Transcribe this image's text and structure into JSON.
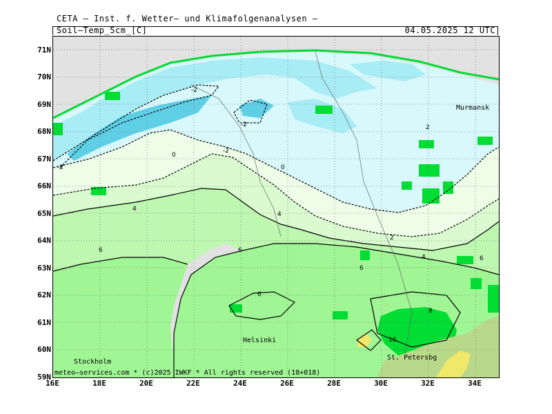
{
  "header": {
    "title": "CETA — Inst. f. Wetter— und Klimafolgenanalysen —",
    "variable": "Soil—Temp_5cm_[C]",
    "datetime": "04.05.2025 12 UTC"
  },
  "map": {
    "lat_labels": [
      "71N",
      "70N",
      "69N",
      "68N",
      "67N",
      "66N",
      "65N",
      "64N",
      "63N",
      "62N",
      "61N",
      "60N",
      "59N"
    ],
    "lon_labels": [
      "16E",
      "18E",
      "20E",
      "22E",
      "24E",
      "26E",
      "28E",
      "30E",
      "32E",
      "34E"
    ],
    "place_labels": {
      "murmansk": "Murmansk",
      "helsinki": "Helsinki",
      "stockholm": "Stockholm",
      "st_petersburg": "St. Petersbg"
    },
    "contour_labels": [
      "-2",
      "-2",
      "-2",
      "0",
      "0",
      "-2",
      "2",
      "4",
      "4",
      "6",
      "6",
      "6",
      "6",
      "4",
      "2",
      "6",
      "8",
      "10"
    ],
    "colors": {
      "below_neg4": "#5fcfe6",
      "neg4_neg2": "#a8ecf5",
      "neg2_0": "#d8f8fb",
      "0_2": "#eefde8",
      "2_4": "#d9fbcf",
      "4_6": "#bdf7b0",
      "6_8": "#a0f595",
      "above_8": "#00dd33",
      "above_10": "#b9d98a",
      "above_12": "#f0e86a",
      "land_missing": "#e2e2e2",
      "water": "#dcdcdc"
    },
    "credit": "meteo—services.com * (c)2025 IWKF * All rights reserved (18+018)"
  }
}
